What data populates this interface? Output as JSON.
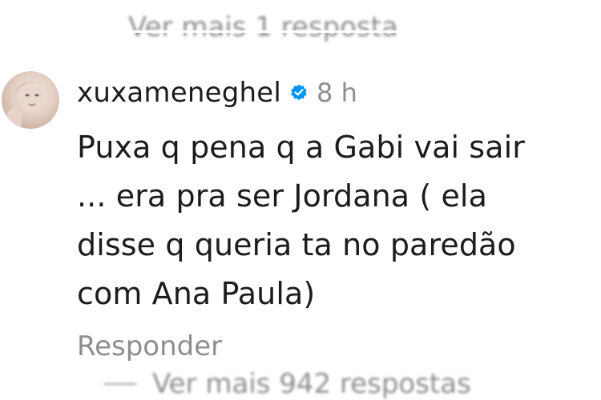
{
  "thread": {
    "more_replies_top": "Ver mais 1 resposta",
    "more_replies_bottom": "Ver mais 942 respostas"
  },
  "comment": {
    "username": "xuxameneghel",
    "verified_icon": "verified-badge-icon",
    "time": "8 h",
    "lines": [
      "Puxa q pena q a Gabi vai sair",
      "... era pra ser Jordana ( ela",
      "disse q queria ta no paredão",
      "com Ana Paula)"
    ],
    "reply_label": "Responder"
  },
  "colors": {
    "accent": "#0095f6",
    "muted": "#8e8e8e",
    "text": "#1c1c1c"
  }
}
